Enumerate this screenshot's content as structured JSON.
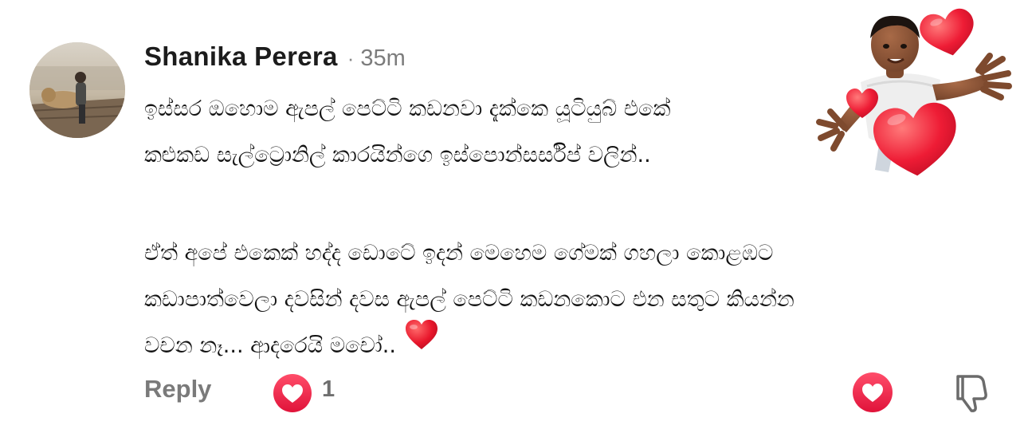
{
  "comment": {
    "author": "Shanika Perera",
    "separator": "·",
    "timestamp": "35m",
    "paragraph1": [
      "ඉස්සර ඔහොම ඇපල් පෙට්ටි කඩනවා දැක්කෙ යූටියුබ් එකේ",
      "කළුකඩ සැල්ට්‍රොනිල් කාරයින්ගෙ ඉස්පොන්සර්සිප් වලින්.."
    ],
    "paragraph2": [
      "ඒත් අපේ එකෙක් හද්ද ඩොටේ ඉදන් මෙහෙම ගේමක් ගහලා කොළඹට",
      "කඩාපාත්වෙලා දවසින් දවස ඇපල් පෙට්ටි කඩනකොට එන සතුට කියන්න",
      "වචන නෑ... ආදරෙයි මචෝ.."
    ],
    "inline_emoji": "red-heart"
  },
  "actions": {
    "reply_label": "Reply",
    "reaction_type": "love",
    "reaction_count": "1"
  },
  "colors": {
    "reaction_red": "#f0284a",
    "muted_text": "#7a7a7a",
    "heart_red": "#e8162b"
  },
  "icons": {
    "reaction_badge": "heart-reaction-icon",
    "like": "heart-like-icon",
    "dislike": "thumbs-down-icon",
    "sticker": "avatar-hearts-sticker"
  }
}
